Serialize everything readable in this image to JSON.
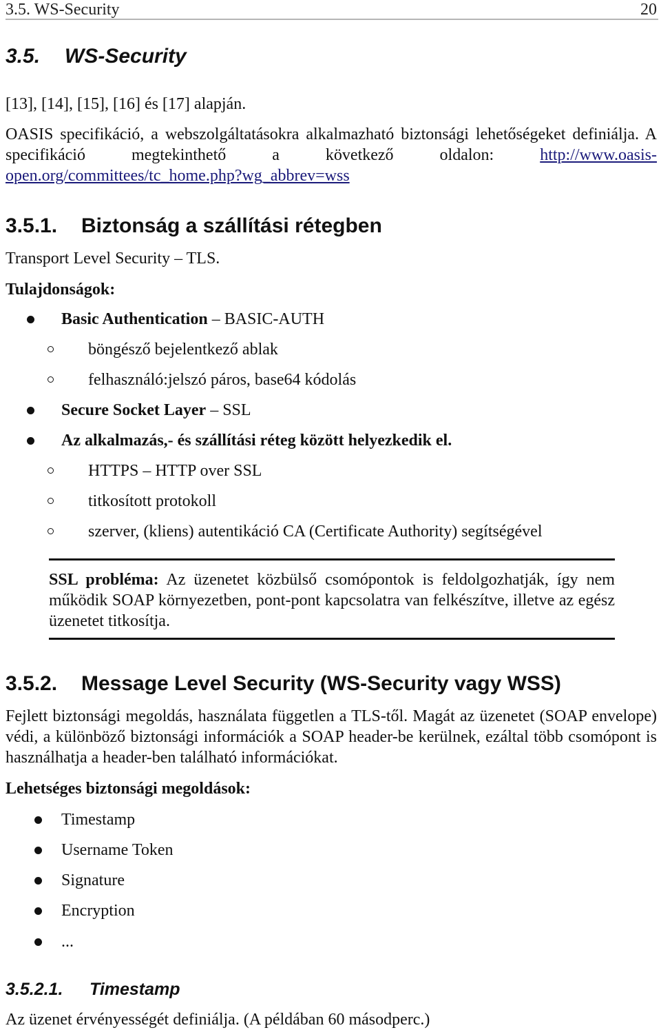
{
  "running_header": {
    "title": "3.5.  WS-Security",
    "page_number": "20"
  },
  "section": {
    "number": "3.5.",
    "title": "WS-Security"
  },
  "refs_line": "[13], [14], [15], [16] és [17] alapján.",
  "intro": {
    "text_before_link": "OASIS specifikáció, a webszolgáltatásokra alkalmazható biztonsági lehetőségeket definiálja. A specifikáció megtekinthető a következő oldalon: ",
    "link_text": "http://www.oasis-open.org/committees/tc_home.php?wg_abbrev=wss",
    "link_color": "#1a1a7a"
  },
  "subsection1": {
    "number": "3.5.1.",
    "title": "Biztonság a szállítási rétegben",
    "lead": "Transport Level Security – TLS.",
    "props_label": "Tulajdonságok:",
    "items": [
      {
        "bold": "Basic Authentication",
        "rest": " – BASIC-AUTH",
        "sub": [
          "böngésző bejelentkező ablak",
          "felhasználó:jelszó páros, base64 kódolás"
        ]
      },
      {
        "bold": "Secure Socket Layer",
        "rest": " – SSL",
        "sub": []
      },
      {
        "bold": "Az alkalmazás,- és szállítási réteg között helyezkedik el.",
        "rest": "",
        "sub": [
          "HTTPS – HTTP over SSL",
          "titkosított protokoll",
          "szerver, (kliens) autentikáció CA (Certificate Authority) segítségével"
        ]
      }
    ],
    "note": {
      "label": "SSL probléma:",
      "text": " Az üzenetet közbülső csomópontok is feldolgozhatják, így nem működik SOAP környezetben, pont-pont kapcsolatra van felkészítve, illetve az egész üzenetet titkosítja."
    }
  },
  "subsection2": {
    "number": "3.5.2.",
    "title": "Message Level Security (WS-Security vagy WSS)",
    "body": "Fejlett biztonsági megoldás, használata független a TLS-től. Magát az üzenetet (SOAP envelope) védi, a különböző biztonsági információk a SOAP header-be kerülnek, ezáltal több csomópont is használhatja a header-ben található információkat.",
    "solutions_label": "Lehetséges biztonsági megoldások:",
    "solutions": [
      "Timestamp",
      "Username Token",
      "Signature",
      "Encryption",
      "..."
    ]
  },
  "subsubsection": {
    "number": "3.5.2.1.",
    "title": "Timestamp",
    "body": "Az üzenet érvényességét definiálja. (A példában 60 másodperc.)"
  }
}
